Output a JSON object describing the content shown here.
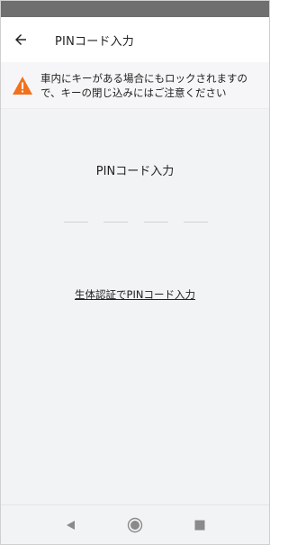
{
  "app_bar": {
    "title": "PINコード入力",
    "back_icon": "arrow-left-icon"
  },
  "warning": {
    "icon": "warning-triangle-icon",
    "icon_color": "#f2711c",
    "message": "車内にキーがある場合にもロックされますので、キーの閉じ込みにはご注意ください"
  },
  "pin": {
    "label": "PINコード入力",
    "slot_count": 4
  },
  "biometric_link": "生体認証でPINコード入力",
  "nav": {
    "back_icon": "nav-back-icon",
    "home_icon": "nav-home-icon",
    "recents_icon": "nav-recents-icon"
  }
}
